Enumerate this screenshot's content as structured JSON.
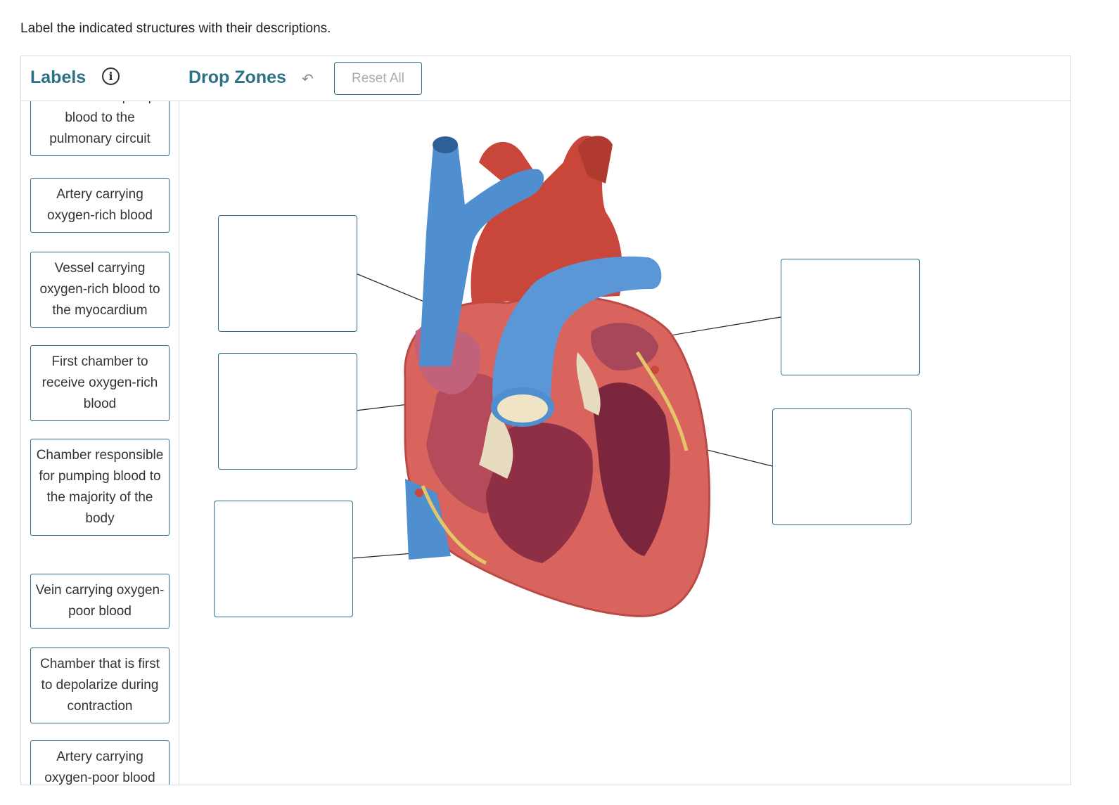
{
  "instruction": "Label the indicated structures with their descriptions.",
  "labels_panel": {
    "title": "Labels",
    "info_icon": "info-icon",
    "items": [
      "Chamber that pumps blood to the pulmonary circuit",
      "Artery carrying oxygen-rich blood",
      "Vessel carrying oxygen-rich blood to the myocardium",
      "First chamber to receive oxygen-rich blood",
      "Chamber responsible for pumping blood to the majority of the body",
      "Vein carrying oxygen-poor blood",
      "Chamber that is first to depolarize during contraction",
      "Artery carrying oxygen-poor blood"
    ]
  },
  "drop_zones_panel": {
    "title": "Drop Zones",
    "undo_icon": "undo-icon",
    "reset_label": "Reset All",
    "zones": [
      "",
      "",
      "",
      "",
      ""
    ]
  },
  "colors": {
    "accent": "#2d7186",
    "border": "#2d6f86",
    "artery_red": "#c9463a",
    "vein_blue": "#4f8fd0",
    "myocardium": "#d9645e"
  }
}
